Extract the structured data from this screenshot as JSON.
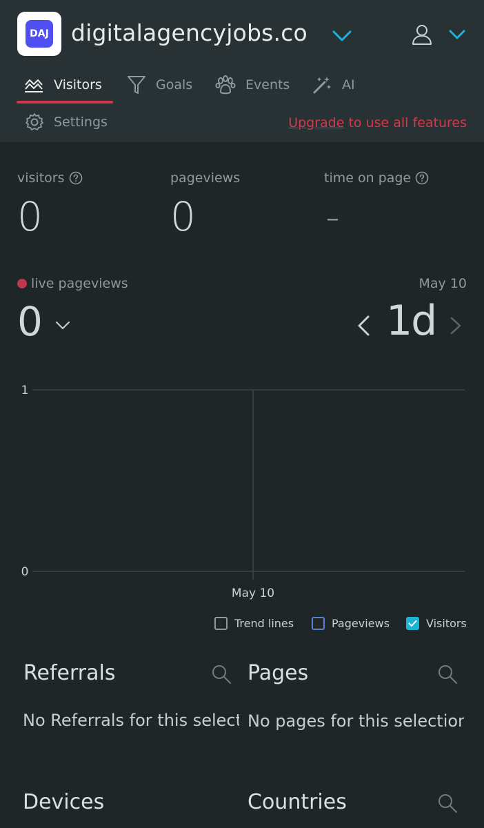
{
  "header": {
    "logo_text": "DAJ",
    "site_name": "digitalagencyjobs.co",
    "tabs": [
      {
        "label": "Visitors"
      },
      {
        "label": "Goals"
      },
      {
        "label": "Events"
      },
      {
        "label": "AI"
      }
    ],
    "settings_label": "Settings",
    "upgrade_link": "Upgrade",
    "upgrade_rest": " to use all features"
  },
  "stats": {
    "visitors_label": "visitors",
    "visitors_value": "0",
    "pageviews_label": "pageviews",
    "pageviews_value": "0",
    "time_label": "time on page",
    "time_value": "-"
  },
  "live": {
    "label": "live pageviews",
    "value": "0",
    "date": "May 10",
    "range": "1d"
  },
  "chart_data": {
    "type": "line",
    "x": [
      "May 10"
    ],
    "series": [
      {
        "name": "Visitors",
        "values": [
          0
        ]
      }
    ],
    "ylim": [
      0,
      1
    ],
    "y_ticks": [
      "0",
      "1"
    ],
    "x_tick_labels": [
      "May 10"
    ],
    "grid": true
  },
  "legend": {
    "items": [
      {
        "label": "Trend lines",
        "checked": false
      },
      {
        "label": "Pageviews",
        "checked": false
      },
      {
        "label": "Visitors",
        "checked": true
      }
    ]
  },
  "panels": {
    "referrals_title": "Referrals",
    "referrals_empty": "No Referrals for this selection",
    "pages_title": "Pages",
    "pages_empty": "No pages for this selection",
    "devices_title": "Devices",
    "countries_title": "Countries"
  },
  "colors": {
    "background": "#1e2628",
    "header": "#283235",
    "accent_red": "#d2384a",
    "accent_cyan": "#1db3d6",
    "logo_blue": "#4f4ff2"
  }
}
